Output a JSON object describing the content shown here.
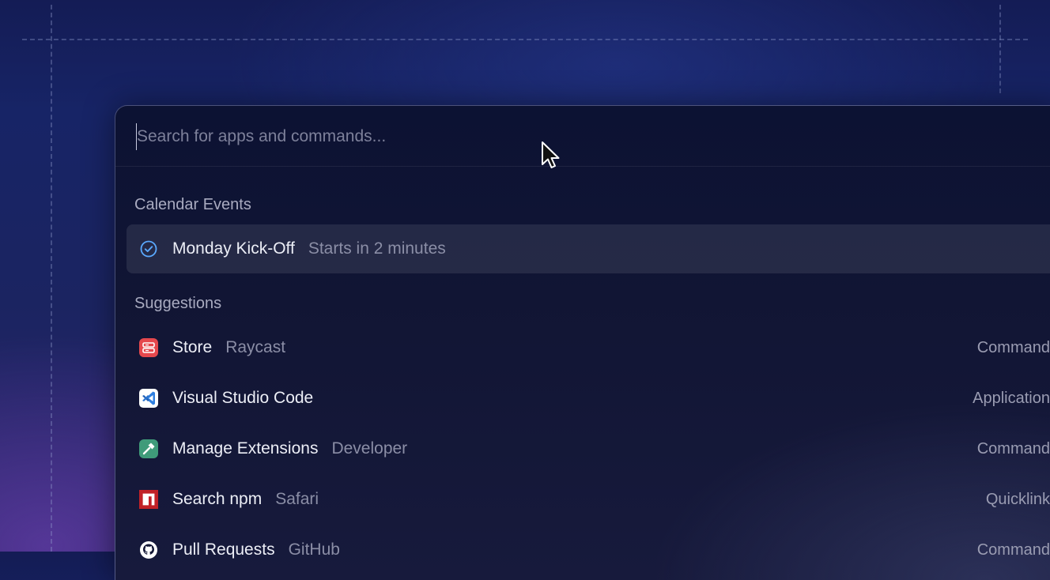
{
  "search": {
    "placeholder": "Search for apps and commands..."
  },
  "sections": [
    {
      "title": "Calendar Events",
      "items": [
        {
          "title": "Monday Kick-Off",
          "subtitle": "Starts in 2 minutes",
          "icon": "check-circle-icon",
          "selected": true
        }
      ]
    },
    {
      "title": "Suggestions",
      "items": [
        {
          "title": "Store",
          "subtitle": "Raycast",
          "accessory": "Command",
          "icon": "raycast-store-icon"
        },
        {
          "title": "Visual Studio Code",
          "subtitle": "",
          "accessory": "Application",
          "icon": "vscode-icon"
        },
        {
          "title": "Manage Extensions",
          "subtitle": "Developer",
          "accessory": "Command",
          "icon": "hammer-icon"
        },
        {
          "title": "Search npm",
          "subtitle": "Safari",
          "accessory": "Quicklink",
          "icon": "npm-icon"
        },
        {
          "title": "Pull Requests",
          "subtitle": "GitHub",
          "accessory": "Command",
          "icon": "github-icon"
        }
      ]
    }
  ],
  "colors": {
    "accent_check": "#5aa9ff",
    "store_red": "#e5484d",
    "vscode_blue": "#2f7fe0",
    "hammer_green": "#3f9b7a",
    "npm_red": "#c12127"
  }
}
